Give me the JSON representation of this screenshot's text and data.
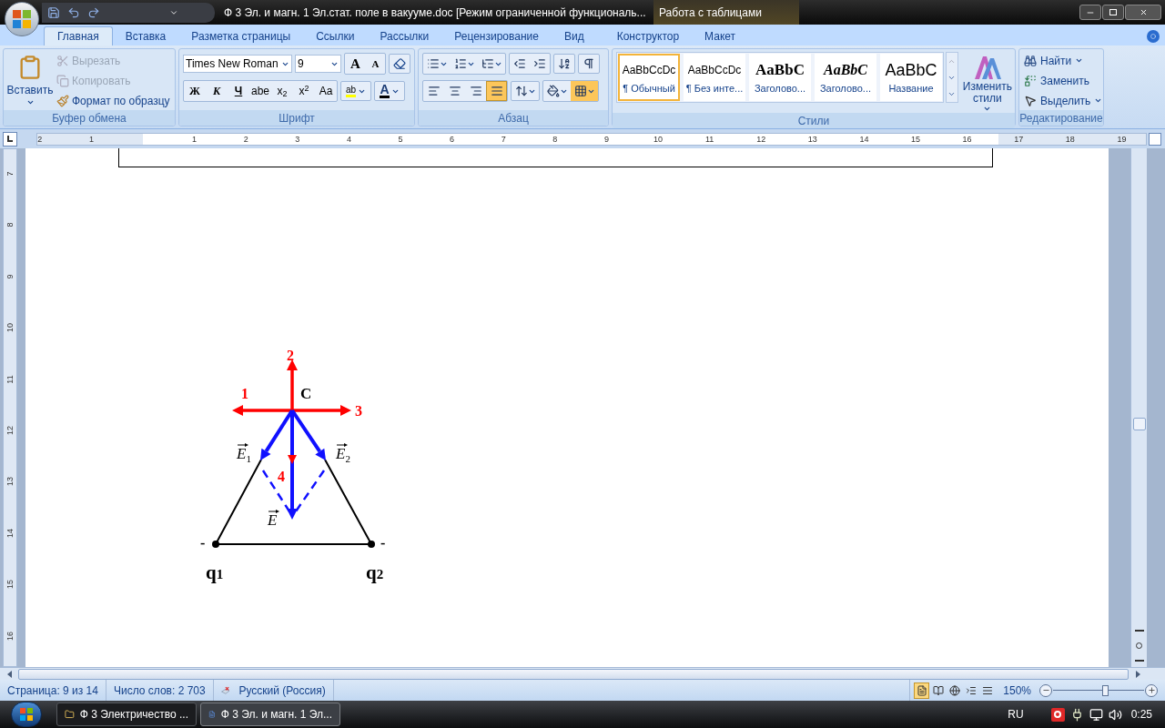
{
  "title_bar": {
    "title": "Ф 3 Эл. и магн. 1 Эл.стат. поле в вакууме.doc [Режим ограниченной функциональ...",
    "contextual_group": "Работа с таблицами"
  },
  "tabs": [
    {
      "label": "Главная",
      "selected": true
    },
    {
      "label": "Вставка",
      "selected": false
    },
    {
      "label": "Разметка страницы",
      "selected": false
    },
    {
      "label": "Ссылки",
      "selected": false
    },
    {
      "label": "Рассылки",
      "selected": false
    },
    {
      "label": "Рецензирование",
      "selected": false
    },
    {
      "label": "Вид",
      "selected": false
    },
    {
      "label": "Конструктор",
      "selected": false
    },
    {
      "label": "Макет",
      "selected": false
    }
  ],
  "clipboard": {
    "title": "Буфер обмена",
    "paste": "Вставить",
    "items": [
      {
        "label": "Вырезать",
        "kind": "cut",
        "disabled": true
      },
      {
        "label": "Копировать",
        "kind": "copy",
        "disabled": true
      },
      {
        "label": "Формат по образцу",
        "kind": "painter",
        "disabled": false
      }
    ]
  },
  "font": {
    "title": "Шрифт",
    "font_name": "Times New Roman",
    "font_size": "9",
    "grow": "A",
    "shrink": "A",
    "format_buttons": [
      "Ж",
      "К",
      "Ч",
      "abe",
      "x$_{2}$",
      "x$^{2}$",
      "Aa"
    ],
    "highlight": "ab",
    "font_color": "A"
  },
  "paragraph": {
    "title": "Абзац",
    "alignments": [
      {
        "kind": "left",
        "selected": false
      },
      {
        "kind": "center",
        "selected": false
      },
      {
        "kind": "right",
        "selected": false
      },
      {
        "kind": "justify",
        "selected": true
      }
    ],
    "borders_selected": true
  },
  "styles": {
    "title": "Стили",
    "items": [
      {
        "preview": "AaBbCcDc",
        "name": "¶ Обычный",
        "kind": "normal",
        "selected": true
      },
      {
        "preview": "AaBbCcDc",
        "name": "¶ Без инте...",
        "kind": "normal",
        "selected": false
      },
      {
        "preview": "AaBbC",
        "name": "Заголово...",
        "kind": "bold",
        "selected": false
      },
      {
        "preview": "AaBbC",
        "name": "Заголово...",
        "kind": "bold-italic",
        "selected": false
      },
      {
        "preview": "AaBbC",
        "name": "Название",
        "kind": "large",
        "selected": false
      }
    ],
    "change": "Изменить стили"
  },
  "editing": {
    "title": "Редактирование",
    "items": [
      {
        "label": "Найти",
        "kind": "find"
      },
      {
        "label": "Заменить",
        "kind": "replace"
      },
      {
        "label": "Выделить",
        "kind": "select"
      }
    ]
  },
  "rulers": {
    "horizontal": [
      "2",
      "1",
      "1",
      "2",
      "3",
      "4",
      "5",
      "6",
      "7",
      "8",
      "9",
      "10",
      "11",
      "12",
      "13",
      "14",
      "15",
      "16",
      "17",
      "18",
      "19"
    ],
    "vertical": [
      "7",
      "8",
      "9",
      "10",
      "11",
      "12",
      "13",
      "14",
      "15",
      "16"
    ]
  },
  "diagram": {
    "point": "C",
    "directions": [
      "1",
      "2",
      "3",
      "4"
    ],
    "fields": [
      {
        "symbol": "E",
        "index": "1"
      },
      {
        "symbol": "E",
        "index": "2"
      },
      {
        "symbol": "E"
      }
    ],
    "charges": [
      {
        "symbol": "q",
        "index": "1",
        "sign": "-"
      },
      {
        "symbol": "q",
        "index": "2",
        "sign": "-"
      }
    ]
  },
  "status_bar": {
    "page": "Страница: 9 из 14",
    "words": "Число слов: 2 703",
    "language": "Русский (Россия)",
    "views": [
      {
        "kind": "print",
        "selected": true
      },
      {
        "kind": "reading",
        "selected": false
      },
      {
        "kind": "web",
        "selected": false
      },
      {
        "kind": "outline",
        "selected": false
      },
      {
        "kind": "draft",
        "selected": false
      }
    ],
    "zoom": "150%",
    "zoom_slider": {
      "level": 0.57
    }
  },
  "taskbar": {
    "items": [
      {
        "label": "Ф 3 Электричество ...",
        "kind": "folder",
        "selected": false
      },
      {
        "label": "Ф 3 Эл. и магн. 1 Эл...",
        "kind": "word",
        "selected": true
      }
    ],
    "language": "RU",
    "clock": "0:25"
  }
}
